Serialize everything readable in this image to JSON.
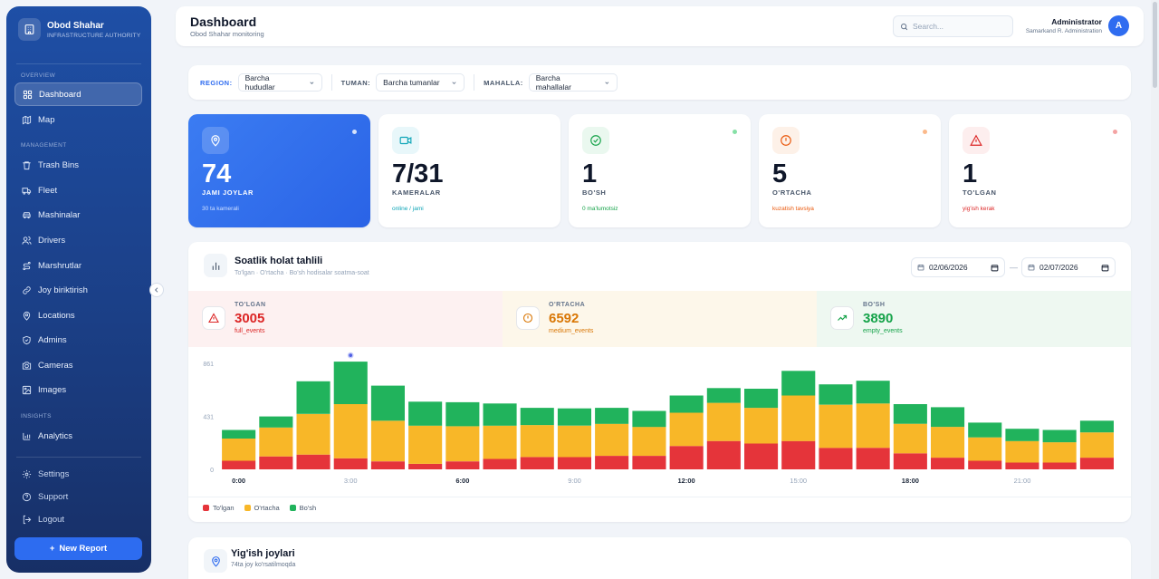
{
  "brand": {
    "name": "Obod Shahar",
    "subtitle": "INFRASTRUCTURE AUTHORITY"
  },
  "sidebar": {
    "sections": {
      "overview": "OVERVIEW",
      "management": "MANAGEMENT",
      "insights": "INSIGHTS"
    },
    "items": [
      {
        "label": "Dashboard",
        "icon": "dashboard-icon",
        "active": true
      },
      {
        "label": "Map",
        "icon": "map-icon"
      },
      {
        "label": "Trash Bins",
        "icon": "trash-icon"
      },
      {
        "label": "Fleet",
        "icon": "truck-icon"
      },
      {
        "label": "Mashinalar",
        "icon": "car-icon"
      },
      {
        "label": "Drivers",
        "icon": "users-icon"
      },
      {
        "label": "Marshrutlar",
        "icon": "route-icon"
      },
      {
        "label": "Joy biriktirish",
        "icon": "link-icon"
      },
      {
        "label": "Locations",
        "icon": "pin-icon"
      },
      {
        "label": "Admins",
        "icon": "shield-icon"
      },
      {
        "label": "Cameras",
        "icon": "camera-icon"
      },
      {
        "label": "Images",
        "icon": "image-icon"
      },
      {
        "label": "Analytics",
        "icon": "bar-chart-icon"
      }
    ],
    "footer": [
      {
        "label": "Settings",
        "icon": "gear-icon"
      },
      {
        "label": "Support",
        "icon": "help-icon"
      },
      {
        "label": "Logout",
        "icon": "logout-icon"
      }
    ],
    "new_report": "New Report"
  },
  "header": {
    "title": "Dashboard",
    "subtitle": "Obod Shahar monitoring",
    "search_placeholder": "Search...",
    "user_name": "Administrator",
    "user_org": "Samarkand R. Administration",
    "avatar": "A"
  },
  "filters": {
    "region_label": "REGION:",
    "region_value": "Barcha hududlar",
    "tuman_label": "TUMAN:",
    "tuman_value": "Barcha tumanlar",
    "mahalla_label": "MAHALLA:",
    "mahalla_value": "Barcha mahallalar"
  },
  "stats": [
    {
      "value": "74",
      "label": "JAMI JOYLAR",
      "note": "30 ta kamerali",
      "icon": "pin-icon",
      "color": "#2f6cf0"
    },
    {
      "value": "7/31",
      "label": "KAMERALAR",
      "note": "online / jami",
      "icon": "video-icon",
      "color": "#0ea5b7"
    },
    {
      "value": "1",
      "label": "BO'SH",
      "note": "0 ma'lumotsiz",
      "icon": "check-circle-icon",
      "color": "#16a34a"
    },
    {
      "value": "5",
      "label": "O'RTACHA",
      "note": "kuzatish tavsiya",
      "icon": "alert-circle-icon",
      "color": "#ea580c"
    },
    {
      "value": "1",
      "label": "TO'LGAN",
      "note": "yig'ish kerak",
      "icon": "warning-icon",
      "color": "#dc2626"
    }
  ],
  "analysis": {
    "title": "Soatlik holat tahlili",
    "subtitle": "To'lgan · O'rtacha · Bo'sh hodisalar soatma-soat",
    "date_from": "02/06/2026",
    "date_to": "02/07/2026",
    "date_sep": "—",
    "summary": [
      {
        "label": "TO'LGAN",
        "value": "3005",
        "key": "full_events",
        "color": "#dc2626",
        "bg": "#fdf1f1",
        "icon": "warning-icon"
      },
      {
        "label": "O'RTACHA",
        "value": "6592",
        "key": "medium_events",
        "color": "#d97706",
        "bg": "#fdf7ea",
        "icon": "alert-circle-icon"
      },
      {
        "label": "BO'SH",
        "value": "3890",
        "key": "empty_events",
        "color": "#16a34a",
        "bg": "#eef8f1",
        "icon": "trend-up-icon"
      }
    ],
    "legend": [
      "To'lgan",
      "O'rtacha",
      "Bo'sh"
    ]
  },
  "chart_data": {
    "type": "bar",
    "stacked": true,
    "categories": [
      "0:00",
      "1:00",
      "2:00",
      "3:00",
      "4:00",
      "5:00",
      "6:00",
      "7:00",
      "8:00",
      "9:00",
      "10:00",
      "11:00",
      "12:00",
      "13:00",
      "14:00",
      "15:00",
      "16:00",
      "17:00",
      "18:00",
      "19:00",
      "20:00",
      "21:00",
      "22:00",
      "23:00"
    ],
    "x_tick_labels": [
      "0:00",
      "3:00",
      "6:00",
      "9:00",
      "12:00",
      "15:00",
      "18:00",
      "21:00"
    ],
    "y_ticks": [
      "861",
      "431",
      "0"
    ],
    "ylim": [
      0,
      861
    ],
    "series": [
      {
        "name": "To'lgan",
        "color": "#e5343a",
        "values": [
          70,
          105,
          120,
          90,
          65,
          45,
          65,
          85,
          100,
          100,
          110,
          110,
          190,
          230,
          210,
          230,
          175,
          175,
          130,
          95,
          70,
          55,
          55,
          95
        ]
      },
      {
        "name": "O'rtacha",
        "color": "#f8b728",
        "values": [
          180,
          235,
          330,
          440,
          330,
          310,
          285,
          270,
          260,
          255,
          260,
          235,
          270,
          310,
          290,
          370,
          350,
          360,
          240,
          250,
          190,
          175,
          165,
          205
        ]
      },
      {
        "name": "Bo'sh",
        "color": "#21b35c",
        "values": [
          70,
          90,
          265,
          345,
          285,
          195,
          195,
          180,
          140,
          140,
          130,
          130,
          140,
          120,
          155,
          200,
          165,
          185,
          160,
          160,
          120,
          100,
          100,
          95
        ]
      }
    ],
    "highlight_index": 3,
    "grid": false
  },
  "locations": {
    "title": "Yig'ish joylari",
    "subtitle": "74ta joy ko'rsatilmoqda"
  }
}
